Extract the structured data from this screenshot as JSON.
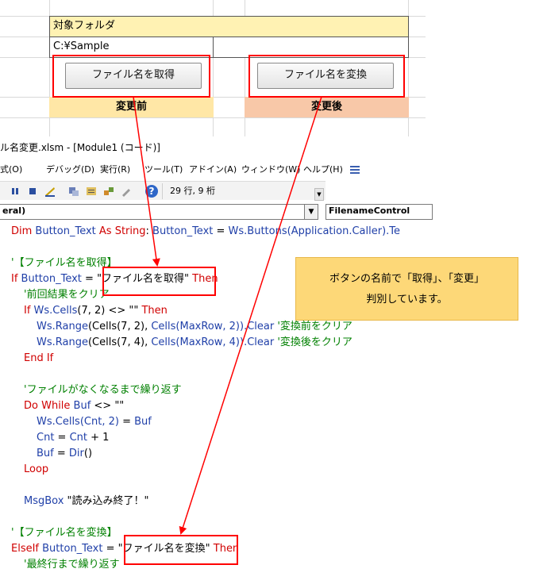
{
  "sheet": {
    "folder_label": "対象フォルダ",
    "folder_value": "C:¥Sample",
    "get_button": "ファイル名を取得",
    "change_button": "ファイル名を変換",
    "before_header": "変更前",
    "after_header": "変更後",
    "colors": {
      "folder_bg": "#fff2b3",
      "before_bg": "#ffe7a6",
      "after_bg": "#f8c8a8"
    }
  },
  "vbe": {
    "title": "ル名変更.xlsm - [Module1 (コード)]",
    "menu": [
      "式(O)",
      "デバッグ(D)",
      "実行(R)",
      "ツール(T)",
      "アドイン(A)",
      "ウィンドウ(W)",
      "ヘルプ(H)"
    ],
    "toolbar_status": "29 行, 9 桁",
    "toolbar_icons": [
      "pause-icon",
      "stop-icon",
      "design-mode-icon",
      "project-explorer-icon",
      "properties-icon",
      "object-browser-icon",
      "toolbox-icon",
      "help-icon"
    ],
    "object_combo": "eral)",
    "proc_combo": "FilenameControl"
  },
  "code": {
    "l1_kw1": "Dim ",
    "l1_id1": "Button_Text ",
    "l1_kw2": "As String",
    "l1_rest1": ": ",
    "l1_id2": "Button_Text",
    "l1_rest2": " = ",
    "l1_id3": "Ws.Buttons(Application.Caller).Te",
    "c_get": "'【ファイル名を取得】",
    "if_kw": "If ",
    "if_id": "Button_Text",
    "if_eq": " = ",
    "if_str": "\"ファイル名を取得\"",
    "if_then": " Then",
    "c_clear_prev": "'前回結果をクリア",
    "if2_kw": "If ",
    "if2_id": "Ws.Cells",
    "if2_rest": "(7, 2) <> \"\"",
    "if2_then": " Then",
    "rng1_a": "Ws.Range",
    "rng1_b": "(Cells(7, 2), ",
    "rng1_c": "Cells(MaxRow, 2)",
    "rng1_d": ").Clear",
    "rng1_cm": " '変換前をクリア",
    "rng2_a": "Ws.Range",
    "rng2_b": "(Cells(7, 4), ",
    "rng2_c": "Cells(MaxRow, 4)",
    "rng2_d": ").Clear",
    "rng2_cm": " '変換後をクリア",
    "end_if": "End If",
    "c_loop": "'ファイルがなくなるまで繰り返す",
    "do_kw": "Do While ",
    "do_id": "Buf",
    "do_rest": " <> \"\"",
    "cells_a": "Ws.Cells(Cnt, 2)",
    "cells_b": " = ",
    "cells_c": "Buf",
    "cnt_a": "Cnt",
    "cnt_b": " = ",
    "cnt_c": "Cnt",
    "cnt_d": " + 1",
    "buf_a": "Buf",
    "buf_b": " = ",
    "buf_c": "Dir",
    "buf_d": "()",
    "loop": "Loop",
    "msg_kw": "MsgBox ",
    "msg_str": "\"読み込み終了！\"",
    "c_change": "'【ファイル名を変換】",
    "elif_kw": "ElseIf ",
    "elif_id": "Button_Text",
    "elif_eq": " = ",
    "elif_str": "\"ファイル名を変換\"",
    "elif_then": " Then",
    "c_last": "'最終行まで繰り返す"
  },
  "note": {
    "line1": "ボタンの名前で「取得」、「変更」",
    "line2": "判別しています。"
  },
  "annotation_color": "#ff0000"
}
